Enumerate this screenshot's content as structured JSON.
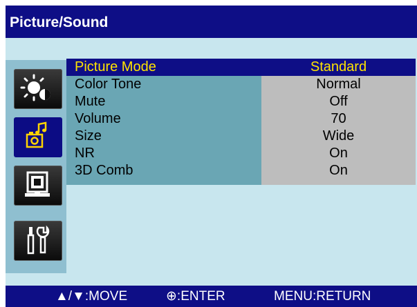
{
  "header": {
    "title": "Picture/Sound"
  },
  "sidebar": {
    "items": [
      {
        "icon": "brightness-contrast-icon",
        "selected": false
      },
      {
        "icon": "picture-sound-icon",
        "selected": true
      },
      {
        "icon": "monitor-icon",
        "selected": false
      },
      {
        "icon": "setup-tools-icon",
        "selected": false
      }
    ]
  },
  "menu": {
    "rows": [
      {
        "label": "Picture Mode",
        "value": "Standard",
        "highlighted": true
      },
      {
        "label": "Color Tone",
        "value": "Normal",
        "highlighted": false
      },
      {
        "label": "Mute",
        "value": "Off",
        "highlighted": false
      },
      {
        "label": "Volume",
        "value": "70",
        "highlighted": false
      },
      {
        "label": "Size",
        "value": "Wide",
        "highlighted": false
      },
      {
        "label": "NR",
        "value": "On",
        "highlighted": false
      },
      {
        "label": "3D Comb",
        "value": "On",
        "highlighted": false
      }
    ]
  },
  "footer": {
    "move": "▲/▼:MOVE",
    "enter": "⊕:ENTER",
    "return": "MENU:RETURN"
  },
  "colors": {
    "title_bar": "#0e0e86",
    "highlight_text": "#ffe400",
    "body_background": "#c8e6ee",
    "label_column": "#6aa6b4",
    "value_column": "#bdbdbd"
  }
}
